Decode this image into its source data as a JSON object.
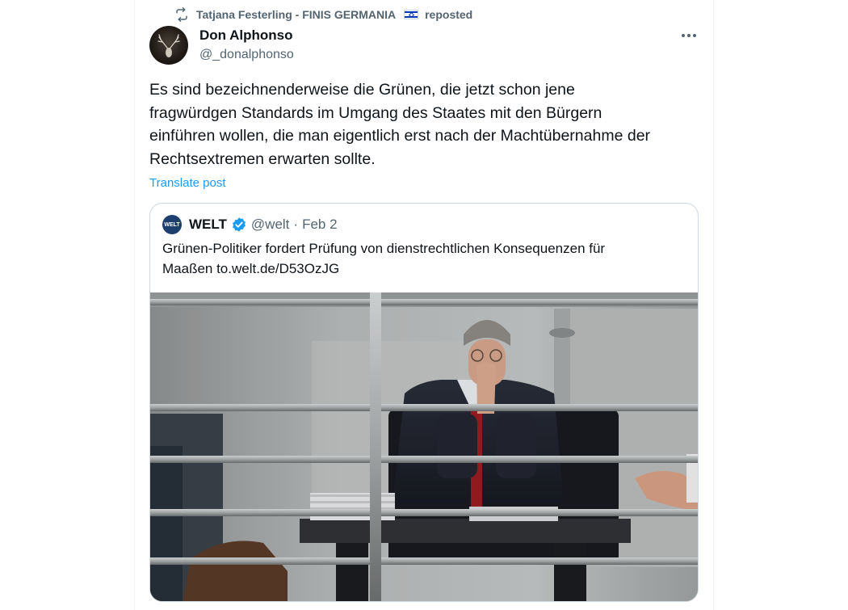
{
  "repost": {
    "icon": "repost-icon",
    "reposter": "Tatjana Festerling - FINIS GERMANIA",
    "flag_icon": "israel-flag-icon",
    "action": "reposted"
  },
  "post": {
    "author_name": "Don Alphonso",
    "author_handle": "@_donalphonso",
    "more_icon": "more-options-icon",
    "text_lines": [
      "Es sind bezeichnenderweise die Grünen, die jetzt schon jene",
      "fragwürdgen Standards im Umgang des Staates mit den Bürgern",
      "einführen wollen, die man eigentlich erst nach der Machtübernahme der",
      "Rechtsextremen erwarten sollte."
    ],
    "translate_label": "Translate post"
  },
  "quote": {
    "avatar_text": "WELT",
    "name": "WELT",
    "verified_icon": "verified-badge-icon",
    "handle": "@welt",
    "separator": "·",
    "date": "Feb 2",
    "text_lines": [
      "Grünen-Politiker fordert Prüfung von dienstrechtlichen Konsequenzen für",
      "Maaßen to.welt.de/D53OzJG"
    ],
    "image_icon": "photo-man-behind-railing"
  },
  "colors": {
    "text_primary": "#0f1419",
    "text_secondary": "#536471",
    "link": "#1d9bf0",
    "border": "#cfd9de",
    "verified": "#1d9bf0"
  }
}
